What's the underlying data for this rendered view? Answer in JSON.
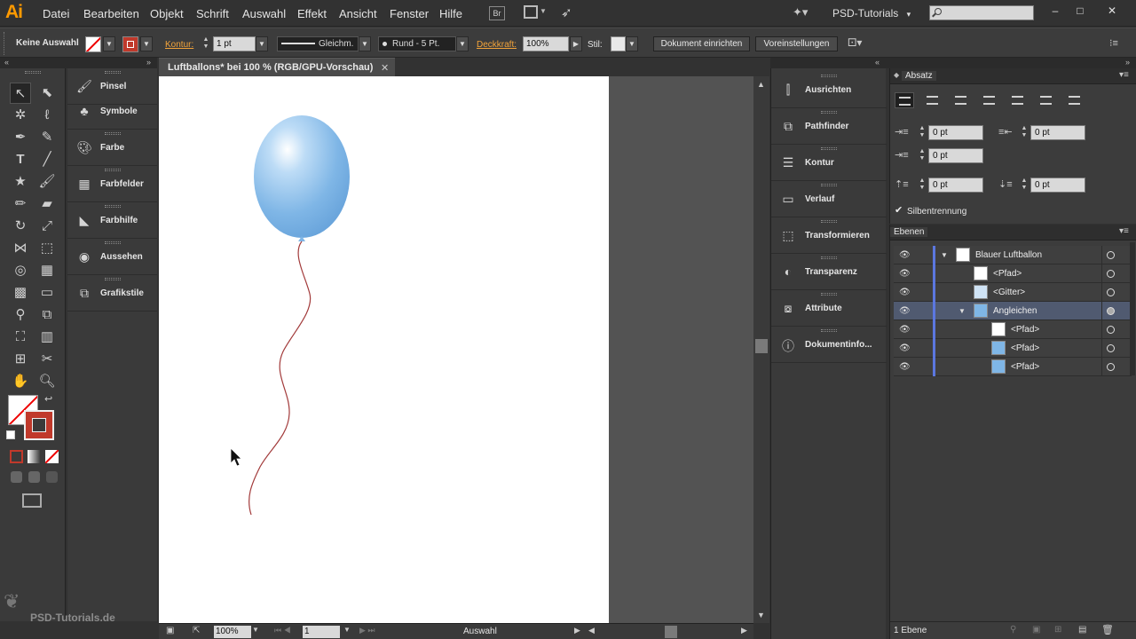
{
  "app": {
    "logo": "Ai"
  },
  "menu": [
    "Datei",
    "Bearbeiten",
    "Objekt",
    "Schrift",
    "Auswahl",
    "Effekt",
    "Ansicht",
    "Fenster",
    "Hilfe"
  ],
  "menubar_icons": {
    "bridge": "Br"
  },
  "workspace": {
    "name": "PSD-Tutorials",
    "arrow": "▾"
  },
  "window_buttons": {
    "minimize": "–",
    "maximize": "□",
    "close": "✕"
  },
  "control": {
    "selection": "Keine Auswahl",
    "kontur_label": "Kontur:",
    "kontur_value": "1 pt",
    "stroke_style": "Gleichm.",
    "brush": "Rund - 5 Pt.",
    "deckkraft_label": "Deckkraft:",
    "deckkraft_value": "100%",
    "stil_label": "Stil:",
    "btn_document": "Dokument einrichten",
    "btn_prefs": "Voreinstellungen"
  },
  "panels_left": [
    {
      "label": "Pinsel",
      "icon": "brush-icon"
    },
    {
      "label": "Symbole",
      "icon": "symbols-icon"
    },
    {
      "label": "Farbe",
      "icon": "palette-icon"
    },
    {
      "label": "Farbfelder",
      "icon": "swatches-icon"
    },
    {
      "label": "Farbhilfe",
      "icon": "color-guide-icon"
    },
    {
      "label": "Aussehen",
      "icon": "appearance-icon"
    },
    {
      "label": "Grafikstile",
      "icon": "graphic-styles-icon"
    }
  ],
  "document": {
    "title": "Luftballons* bei 100 % (RGB/GPU-Vorschau)",
    "close": "✕",
    "zoom": "100%",
    "artboard_num": "1",
    "status": "Auswahl"
  },
  "panels_middle": [
    {
      "label": "Ausrichten",
      "icon": "align-icon"
    },
    {
      "label": "Pathfinder",
      "icon": "pathfinder-icon"
    },
    {
      "label": "Kontur",
      "icon": "stroke-icon"
    },
    {
      "label": "Verlauf",
      "icon": "gradient-icon"
    },
    {
      "label": "Transformieren",
      "icon": "transform-icon"
    },
    {
      "label": "Transparenz",
      "icon": "transparency-icon"
    },
    {
      "label": "Attribute",
      "icon": "attributes-icon"
    },
    {
      "label": "Dokumentinfo...",
      "icon": "document-info-icon"
    }
  ],
  "absatz": {
    "title": "Absatz",
    "indent_left": "0 pt",
    "indent_right": "0 pt",
    "indent_first": "0 pt",
    "space_before": "0 pt",
    "space_after": "0 pt",
    "hyphenation": "Silbentrennung"
  },
  "ebenen": {
    "title": "Ebenen",
    "layers": [
      {
        "name": "Blauer Luftballon",
        "indent": 0,
        "expanded": true
      },
      {
        "name": "<Pfad>",
        "indent": 1
      },
      {
        "name": "<Gitter>",
        "indent": 1
      },
      {
        "name": "Angleichen",
        "indent": 1,
        "expanded": true,
        "selected": true
      },
      {
        "name": "<Pfad>",
        "indent": 2
      },
      {
        "name": "<Pfad>",
        "indent": 2
      },
      {
        "name": "<Pfad>",
        "indent": 2
      }
    ],
    "footer": "1 Ebene"
  },
  "watermark": "PSD-Tutorials.de",
  "colors": {
    "balloon": "#7fb6e6",
    "string": "#a23a3a",
    "accent": "#f2a33a",
    "layer_bar": "#5b77e0"
  }
}
